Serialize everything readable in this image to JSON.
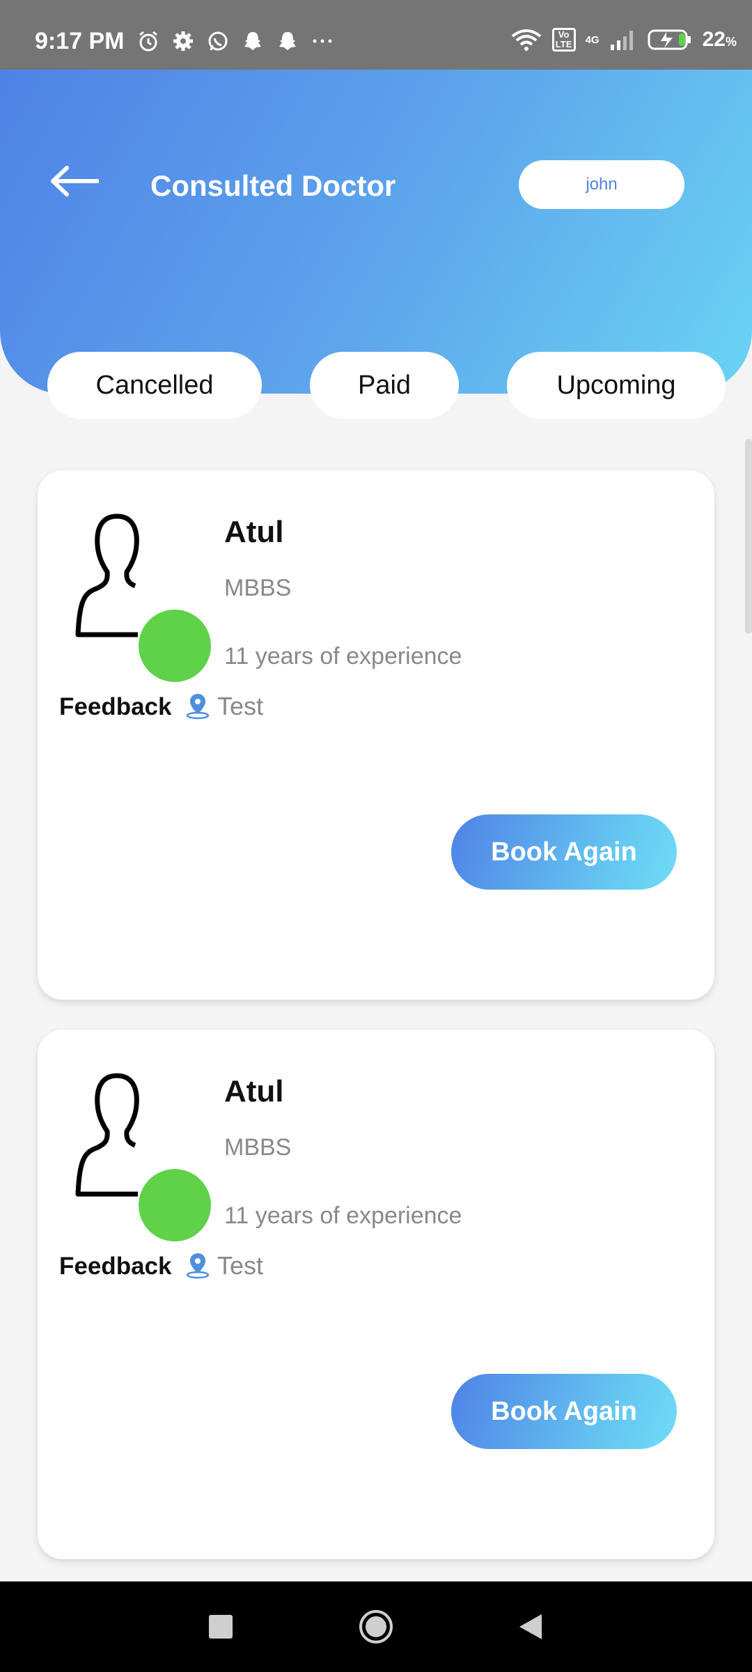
{
  "status_bar": {
    "time": "9:17 PM",
    "battery": "22",
    "battery_unit": "%",
    "network": "4G",
    "volte": "Vo LTE",
    "left_icons": [
      "alarm-icon",
      "settings-icon",
      "whatsapp-icon",
      "snapchat-icon",
      "snapchat-icon",
      "more-dots-icon"
    ]
  },
  "header": {
    "title": "Consulted Doctor",
    "user_name": "john"
  },
  "tabs": [
    {
      "label": "Cancelled"
    },
    {
      "label": "Paid"
    },
    {
      "label": "Upcoming"
    }
  ],
  "doctors": [
    {
      "name": "Atul",
      "degree": "MBBS",
      "experience": "11 years of experience",
      "feedback_label": "Feedback",
      "location": "Test",
      "action_label": "Book Again"
    },
    {
      "name": "Atul",
      "degree": "MBBS",
      "experience": "11 years of experience",
      "feedback_label": "Feedback",
      "location": "Test",
      "action_label": "Book Again"
    }
  ],
  "colors": {
    "header_gradient_start": "#4f82e6",
    "header_gradient_end": "#6ad4f3",
    "status_online": "#5fd24a"
  }
}
